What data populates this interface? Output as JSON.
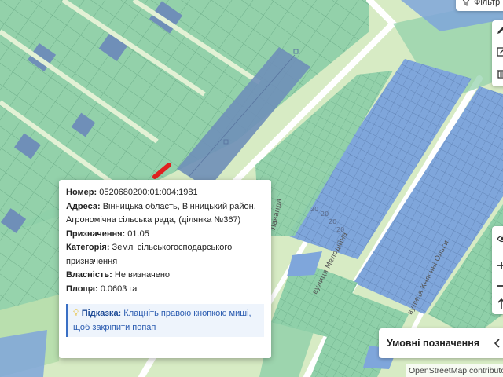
{
  "toolbar": {
    "filter_label": "Фільтр"
  },
  "tools": {
    "draw_icon": "pencil-icon",
    "edit_icon": "edit-shape-icon",
    "delete_icon": "trash-icon",
    "visibility_icon": "eye-icon",
    "zoom_in_icon": "plus-icon",
    "zoom_out_icon": "minus-icon",
    "north_icon": "arrow-up-icon"
  },
  "map_labels": {
    "streets": [
      "вулиця Мелодійна",
      "вулиця Княгині Ольги",
      "Лаванда"
    ],
    "parcel_numbers": [
      "20",
      "20",
      "20",
      "20"
    ]
  },
  "popup": {
    "cadastral_label": "Номер:",
    "cadastral_value": "0520680200:01:004:1981",
    "address_label": "Адреса:",
    "address_value": "Вінницька область, Вінницький район, Агрономічна сільська рада, (ділянка №367)",
    "purpose_label": "Призначення:",
    "purpose_value": "01.05",
    "category_label": "Категорія:",
    "category_value": "Землі сільськогосподарського призначення",
    "ownership_label": "Власність:",
    "ownership_value": "Не визначено",
    "area_label": "Площа:",
    "area_value": "0.0603 га",
    "hint_label": "Підказка:",
    "hint_value": "Клацніть правою кнопкою миші, щоб закріпити попап"
  },
  "legend": {
    "label": "Умовні позначення"
  },
  "attribution": "OpenStreetMap contributors",
  "colors": {
    "land_base": "#d7ebc4",
    "parcel_green": "#8fd0a9",
    "parcel_blue": "#7fa6db",
    "parcel_dark": "#6f8fb8",
    "road": "#ffffff",
    "highlight_red": "#e02020",
    "hint_blue": "#2a5bb0"
  }
}
